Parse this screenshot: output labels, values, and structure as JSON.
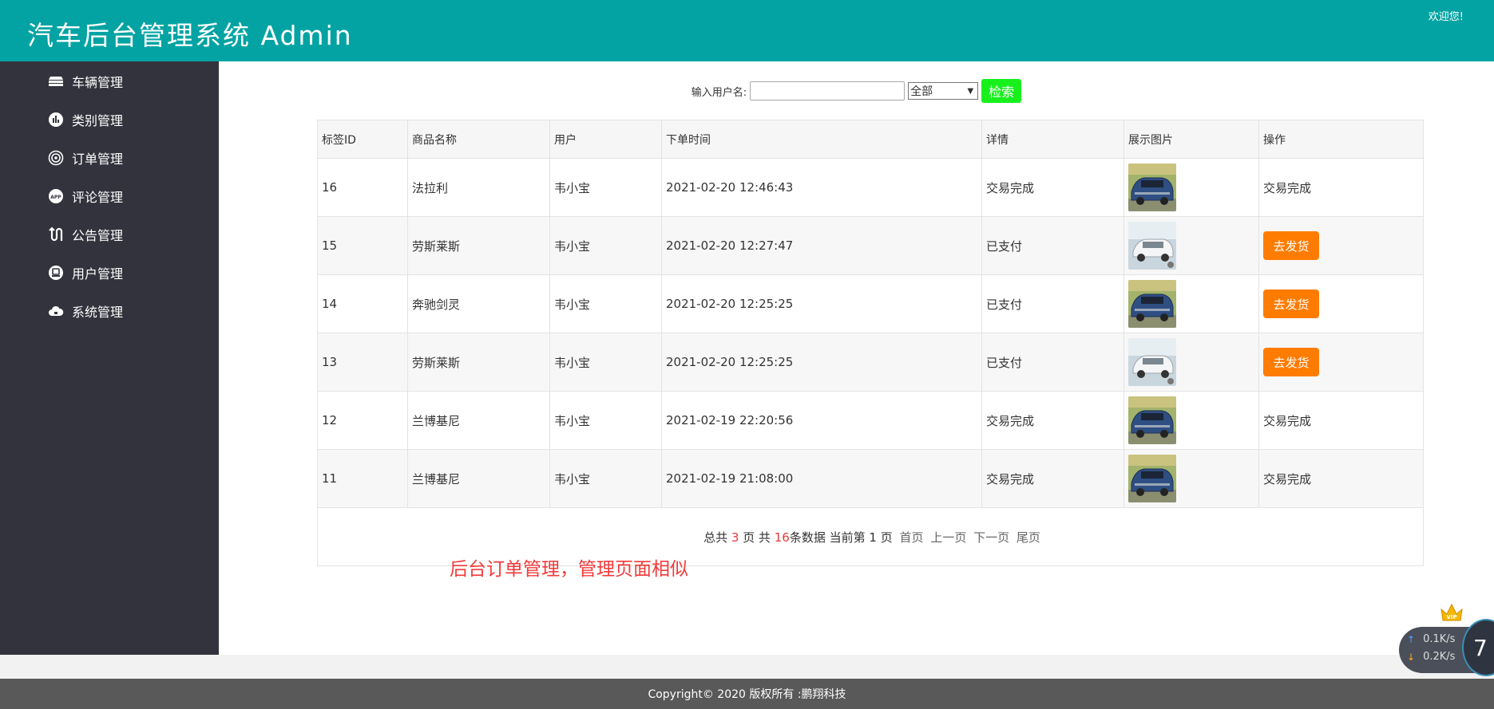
{
  "header": {
    "title": "汽车后台管理系统 Admin",
    "welcome": "欢迎您!"
  },
  "sidebar": {
    "items": [
      {
        "label": "车辆管理",
        "icon": "car-stack-icon"
      },
      {
        "label": "类别管理",
        "icon": "bar-chart-icon"
      },
      {
        "label": "订单管理",
        "icon": "target-icon"
      },
      {
        "label": "评论管理",
        "icon": "app-icon"
      },
      {
        "label": "公告管理",
        "icon": "swap-icon"
      },
      {
        "label": "用户管理",
        "icon": "user-icon"
      },
      {
        "label": "系统管理",
        "icon": "cloud-icon"
      }
    ]
  },
  "search": {
    "label": "输入用户名:",
    "value": "",
    "placeholder": "",
    "filter_selected": "全部",
    "button_label": "检索"
  },
  "table": {
    "columns": [
      "标签ID",
      "商品名称",
      "用户",
      "下单时间",
      "详情",
      "展示图片",
      "操作"
    ],
    "rows": [
      {
        "id": "16",
        "product": "法拉利",
        "user": "韦小宝",
        "time": "2021-02-20 12:46:43",
        "detail": "交易完成",
        "image": "blue-suv",
        "action": "交易完成",
        "action_is_button": false
      },
      {
        "id": "15",
        "product": "劳斯莱斯",
        "user": "韦小宝",
        "time": "2021-02-20 12:27:47",
        "detail": "已支付",
        "image": "white-mpv",
        "action": "去发货",
        "action_is_button": true
      },
      {
        "id": "14",
        "product": "奔驰剑灵",
        "user": "韦小宝",
        "time": "2021-02-20 12:25:25",
        "detail": "已支付",
        "image": "blue-suv",
        "action": "去发货",
        "action_is_button": true
      },
      {
        "id": "13",
        "product": "劳斯莱斯",
        "user": "韦小宝",
        "time": "2021-02-20 12:25:25",
        "detail": "已支付",
        "image": "white-mpv",
        "action": "去发货",
        "action_is_button": true
      },
      {
        "id": "12",
        "product": "兰博基尼",
        "user": "韦小宝",
        "time": "2021-02-19 22:20:56",
        "detail": "交易完成",
        "image": "blue-suv",
        "action": "交易完成",
        "action_is_button": false
      },
      {
        "id": "11",
        "product": "兰博基尼",
        "user": "韦小宝",
        "time": "2021-02-19 21:08:00",
        "detail": "交易完成",
        "image": "blue-suv",
        "action": "交易完成",
        "action_is_button": false
      }
    ]
  },
  "pager": {
    "prefix": "总共",
    "total_pages": "3",
    "pages_suffix": "页 共",
    "total_records": "16",
    "records_suffix": "条数据 当前第",
    "current_page": "1",
    "current_suffix": "页",
    "first": "首页",
    "prev": "上一页",
    "next": "下一页",
    "last": "尾页"
  },
  "annotation": "后台订单管理，管理页面相似",
  "footer": "Copyright© 2020 版权所有 :鹏翔科技",
  "net_widget": {
    "upload": "0.1K/s",
    "download": "0.2K/s",
    "badge_number": "7",
    "badge_label": "VIP"
  },
  "colors": {
    "header": "#03a3a3",
    "sidebar": "#33333d",
    "search_button": "#18f01c",
    "ship_button": "#ff7c00",
    "annotation": "#f23a3a",
    "footer": "#595959"
  }
}
